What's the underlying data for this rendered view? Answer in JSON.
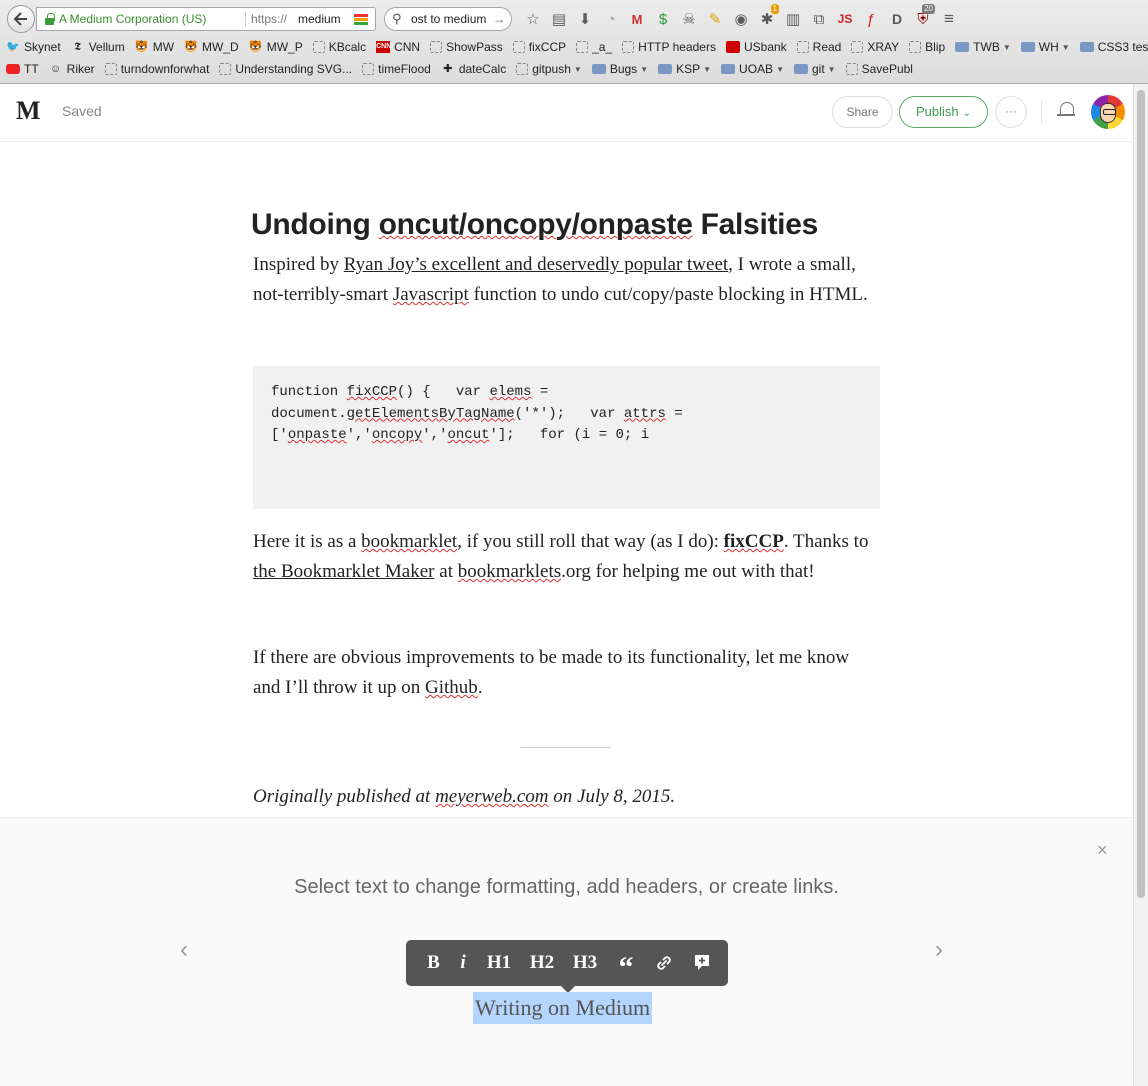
{
  "browser": {
    "site_identity": "A Medium Corporation (US)",
    "url_protocol": "https://",
    "url_host": "medium",
    "search_text": "ost to medium",
    "bookmarks_row1": [
      {
        "label": "Skynet",
        "icon": "twitter-icon"
      },
      {
        "label": "Vellum",
        "icon": "nyt-icon"
      },
      {
        "label": "MW",
        "icon": "tiger-icon"
      },
      {
        "label": "MW_D",
        "icon": "tiger-icon"
      },
      {
        "label": "MW_P",
        "icon": "tiger-icon"
      },
      {
        "label": "KBcalc",
        "icon": "dashed-box-icon"
      },
      {
        "label": "CNN",
        "icon": "cnn-icon"
      },
      {
        "label": "ShowPass",
        "icon": "dashed-box-icon"
      },
      {
        "label": "fixCCP",
        "icon": "dashed-box-icon"
      },
      {
        "label": "_a_",
        "icon": "dashed-box-icon"
      },
      {
        "label": "HTTP headers",
        "icon": "dashed-box-icon"
      },
      {
        "label": "USbank",
        "icon": "shield-icon"
      },
      {
        "label": "Read",
        "icon": "dashed-box-icon"
      },
      {
        "label": "XRAY",
        "icon": "dashed-box-icon"
      },
      {
        "label": "Blip",
        "icon": "dashed-box-icon"
      },
      {
        "label": "TWB",
        "icon": "folder-icon",
        "menu": true
      },
      {
        "label": "WH",
        "icon": "folder-icon",
        "menu": true
      },
      {
        "label": "CSS3 tests",
        "icon": "folder-icon",
        "menu": true
      }
    ],
    "bookmarks_row2": [
      {
        "label": "TT",
        "icon": "youtube-icon"
      },
      {
        "label": "Riker",
        "icon": "riker-icon"
      },
      {
        "label": "turndownforwhat",
        "icon": "dashed-box-icon"
      },
      {
        "label": "Understanding SVG...",
        "icon": "dashed-box-icon"
      },
      {
        "label": "timeFlood",
        "icon": "dashed-box-icon"
      },
      {
        "label": "dateCalc",
        "icon": "calc-icon"
      },
      {
        "label": "gitpush",
        "icon": "dashed-box-icon",
        "menu": true
      },
      {
        "label": "Bugs",
        "icon": "folder-icon",
        "menu": true
      },
      {
        "label": "KSP",
        "icon": "folder-icon",
        "menu": true
      },
      {
        "label": "UOAB",
        "icon": "folder-icon",
        "menu": true
      },
      {
        "label": "git",
        "icon": "folder-icon",
        "menu": true
      },
      {
        "label": "SavePubl",
        "icon": "dashed-box-icon"
      }
    ],
    "toolbar_badges": {
      "ext1": "1",
      "ext2": "20",
      "ext3": "1"
    }
  },
  "medium": {
    "logo": "M",
    "status": "Saved",
    "share_label": "Share",
    "publish_label": "Publish",
    "more_label": "···"
  },
  "article": {
    "title_1": "Undoing ",
    "title_2": "oncut/oncopy/onpaste",
    "title_3": " Falsities",
    "p1_a": "Inspired by ",
    "p1_link": "Ryan Joy’s excellent and deservedly popular tweet",
    "p1_b": ", I wrote a small, not-terribly-smart ",
    "p1_js": "Javascript",
    "p1_c": " function to undo cut/copy/paste blocking in HTML.",
    "code_1": "function ",
    "code_fn": "fixCCP",
    "code_2": "() {   var ",
    "code_elems": "elems",
    "code_3": " =",
    "code_4": "document.",
    "code_gebt": "getElementsByTagName",
    "code_5": "('*');   var ",
    "code_attrs": "attrs",
    "code_6": " =",
    "code_7": "['",
    "code_onpaste": "onpaste",
    "code_8": "','",
    "code_oncopy": "oncopy",
    "code_9": "','",
    "code_oncut": "oncut",
    "code_10": "'];   for (i = 0; i",
    "p2_a": "Here it is as a ",
    "p2_bookmarklet": "bookmarklet",
    "p2_b": ", if you still roll that way (as I do): ",
    "p2_fix": "fixCCP",
    "p2_c": ". Thanks to ",
    "p2_maker": "the Bookmarklet Maker",
    "p2_d": " at ",
    "p2_bms": "bookmarklets",
    "p2_e": ".org for helping me out with that!",
    "p3_a": "If there are obvious improvements to be made to its functionality, let me know and I’ll throw it up on ",
    "p3_github": "Github",
    "p3_b": ".",
    "orig_a": "Originally published at ",
    "orig_link": "meyerweb.com",
    "orig_b": " on July 8, 2015."
  },
  "tips": {
    "close": "×",
    "text": "Select text to change formatting, add headers, or create links.",
    "prev": "‹",
    "next": "›",
    "buttons": [
      "B",
      "i",
      "H1",
      "H2",
      "H3",
      "“",
      "link",
      "+"
    ],
    "sample": "Writing on Medium"
  }
}
